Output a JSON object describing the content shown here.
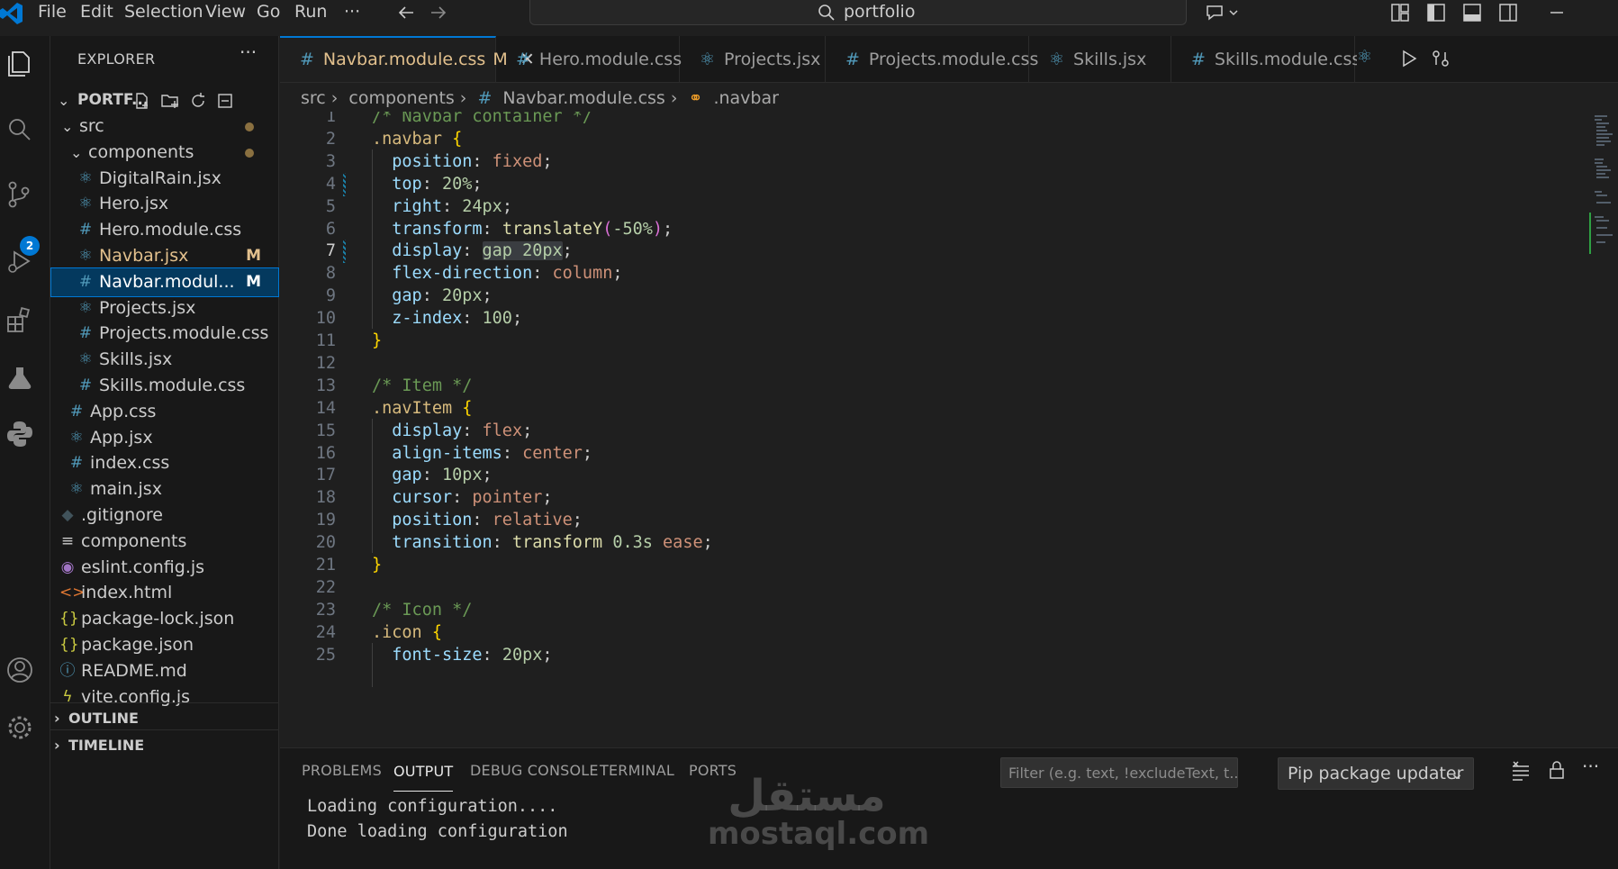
{
  "menu": [
    "File",
    "Edit",
    "Selection",
    "View",
    "Go",
    "Run",
    "···"
  ],
  "search": {
    "value": "portfolio"
  },
  "explorer": {
    "title": "EXPLORER",
    "more": "···",
    "root": "PORTF...",
    "rows": [
      {
        "label": "src",
        "kind": "folder",
        "indent": 1,
        "dot": true
      },
      {
        "label": "components",
        "kind": "folder",
        "indent": 2,
        "dot": true
      },
      {
        "label": "DigitalRain.jsx",
        "kind": "jsx",
        "indent": 3
      },
      {
        "label": "Hero.jsx",
        "kind": "jsx",
        "indent": 3
      },
      {
        "label": "Hero.module.css",
        "kind": "css",
        "indent": 3
      },
      {
        "label": "Navbar.jsx",
        "kind": "jsx",
        "indent": 3,
        "badge": "M"
      },
      {
        "label": "Navbar.modul...",
        "kind": "css",
        "indent": 3,
        "badge": "M",
        "selected": true
      },
      {
        "label": "Projects.jsx",
        "kind": "jsx",
        "indent": 3
      },
      {
        "label": "Projects.module.css",
        "kind": "css",
        "indent": 3
      },
      {
        "label": "Skills.jsx",
        "kind": "jsx",
        "indent": 3
      },
      {
        "label": "Skills.module.css",
        "kind": "css",
        "indent": 3
      },
      {
        "label": "App.css",
        "kind": "css",
        "indent": 2
      },
      {
        "label": "App.jsx",
        "kind": "jsx",
        "indent": 2
      },
      {
        "label": "index.css",
        "kind": "css",
        "indent": 2
      },
      {
        "label": "main.jsx",
        "kind": "jsx",
        "indent": 2
      },
      {
        "label": ".gitignore",
        "kind": "git",
        "indent": 1
      },
      {
        "label": "components",
        "kind": "txt",
        "indent": 1
      },
      {
        "label": "eslint.config.js",
        "kind": "eslint",
        "indent": 1
      },
      {
        "label": "index.html",
        "kind": "html",
        "indent": 1
      },
      {
        "label": "package-lock.json",
        "kind": "json",
        "indent": 1
      },
      {
        "label": "package.json",
        "kind": "json",
        "indent": 1
      },
      {
        "label": "README.md",
        "kind": "info",
        "indent": 1
      },
      {
        "label": "vite.config.js",
        "kind": "vite",
        "indent": 1
      }
    ],
    "outline": "OUTLINE",
    "timeline": "TIMELINE"
  },
  "tabs": [
    {
      "label": "Navbar.module.css",
      "badge": "M",
      "active": true,
      "kind": "css"
    },
    {
      "label": "Hero.module.css",
      "kind": "css"
    },
    {
      "label": "Projects.jsx",
      "kind": "jsx"
    },
    {
      "label": "Projects.module.css",
      "kind": "css"
    },
    {
      "label": "Skills.jsx",
      "kind": "jsx"
    },
    {
      "label": "Skills.module.css",
      "kind": "css"
    }
  ],
  "breadcrumb": {
    "src": "src",
    "components": "components",
    "file": "Navbar.module.css",
    "symbol": ".navbar"
  },
  "active_line": 7,
  "code": [
    {
      "n": "1",
      "tokens": [
        [
          "c",
          "/* Navbar container */"
        ]
      ]
    },
    {
      "n": "2",
      "tokens": [
        [
          "s",
          ".navbar"
        ],
        [
          "p",
          " "
        ],
        [
          "b",
          "{"
        ]
      ]
    },
    {
      "n": "3",
      "tokens": [
        [
          "p",
          "  "
        ],
        [
          "k",
          "position"
        ],
        [
          "p",
          ": "
        ],
        [
          "v",
          "fixed"
        ],
        [
          "p",
          ";"
        ]
      ]
    },
    {
      "n": "4",
      "tokens": [
        [
          "p",
          "  "
        ],
        [
          "k",
          "top"
        ],
        [
          "p",
          ": "
        ],
        [
          "num",
          "20%"
        ],
        [
          "p",
          ";"
        ]
      ]
    },
    {
      "n": "5",
      "tokens": [
        [
          "p",
          "  "
        ],
        [
          "k",
          "right"
        ],
        [
          "p",
          ": "
        ],
        [
          "num",
          "24px"
        ],
        [
          "p",
          ";"
        ]
      ]
    },
    {
      "n": "6",
      "tokens": [
        [
          "p",
          "  "
        ],
        [
          "k",
          "transform"
        ],
        [
          "p",
          ": "
        ],
        [
          "f",
          "translateY"
        ],
        [
          "r",
          "("
        ],
        [
          "num",
          "-50%"
        ],
        [
          "r",
          ")"
        ],
        [
          "p",
          ";"
        ]
      ]
    },
    {
      "n": "7",
      "tokens": [
        [
          "p",
          "  "
        ],
        [
          "k",
          "display"
        ],
        [
          "p",
          ": "
        ],
        [
          "hl",
          "gap 20px"
        ],
        [
          "p",
          ";"
        ]
      ]
    },
    {
      "n": "8",
      "tokens": [
        [
          "p",
          "  "
        ],
        [
          "k",
          "flex-direction"
        ],
        [
          "p",
          ": "
        ],
        [
          "v",
          "column"
        ],
        [
          "p",
          ";"
        ]
      ]
    },
    {
      "n": "9",
      "tokens": [
        [
          "p",
          "  "
        ],
        [
          "k",
          "gap"
        ],
        [
          "p",
          ": "
        ],
        [
          "num",
          "20px"
        ],
        [
          "p",
          ";"
        ]
      ]
    },
    {
      "n": "10",
      "tokens": [
        [
          "p",
          "  "
        ],
        [
          "k",
          "z-index"
        ],
        [
          "p",
          ": "
        ],
        [
          "num",
          "100"
        ],
        [
          "p",
          ";"
        ]
      ]
    },
    {
      "n": "11",
      "tokens": [
        [
          "b",
          "}"
        ]
      ]
    },
    {
      "n": "12",
      "tokens": []
    },
    {
      "n": "13",
      "tokens": [
        [
          "c",
          "/* Item */"
        ]
      ]
    },
    {
      "n": "14",
      "tokens": [
        [
          "s",
          ".navItem"
        ],
        [
          "p",
          " "
        ],
        [
          "b",
          "{"
        ]
      ]
    },
    {
      "n": "15",
      "tokens": [
        [
          "p",
          "  "
        ],
        [
          "k",
          "display"
        ],
        [
          "p",
          ": "
        ],
        [
          "v",
          "flex"
        ],
        [
          "p",
          ";"
        ]
      ]
    },
    {
      "n": "16",
      "tokens": [
        [
          "p",
          "  "
        ],
        [
          "k",
          "align-items"
        ],
        [
          "p",
          ": "
        ],
        [
          "v",
          "center"
        ],
        [
          "p",
          ";"
        ]
      ]
    },
    {
      "n": "17",
      "tokens": [
        [
          "p",
          "  "
        ],
        [
          "k",
          "gap"
        ],
        [
          "p",
          ": "
        ],
        [
          "num",
          "10px"
        ],
        [
          "p",
          ";"
        ]
      ]
    },
    {
      "n": "18",
      "tokens": [
        [
          "p",
          "  "
        ],
        [
          "k",
          "cursor"
        ],
        [
          "p",
          ": "
        ],
        [
          "v",
          "pointer"
        ],
        [
          "p",
          ";"
        ]
      ]
    },
    {
      "n": "19",
      "tokens": [
        [
          "p",
          "  "
        ],
        [
          "k",
          "position"
        ],
        [
          "p",
          ": "
        ],
        [
          "v",
          "relative"
        ],
        [
          "p",
          ";"
        ]
      ]
    },
    {
      "n": "20",
      "tokens": [
        [
          "p",
          "  "
        ],
        [
          "k",
          "transition"
        ],
        [
          "p",
          ": "
        ],
        [
          "t",
          "transform "
        ],
        [
          "num",
          "0.3s"
        ],
        [
          "p",
          " "
        ],
        [
          "v",
          "ease"
        ],
        [
          "p",
          ";"
        ]
      ]
    },
    {
      "n": "21",
      "tokens": [
        [
          "b",
          "}"
        ]
      ]
    },
    {
      "n": "22",
      "tokens": []
    },
    {
      "n": "23",
      "tokens": [
        [
          "c",
          "/* Icon */"
        ]
      ]
    },
    {
      "n": "24",
      "tokens": [
        [
          "s",
          ".icon"
        ],
        [
          "p",
          " "
        ],
        [
          "b",
          "{"
        ]
      ]
    },
    {
      "n": "25",
      "tokens": [
        [
          "p",
          "  "
        ],
        [
          "k",
          "font-size"
        ],
        [
          "p",
          ": "
        ],
        [
          "num",
          "20px"
        ],
        [
          "p",
          ";"
        ]
      ]
    }
  ],
  "panel": {
    "tabs": [
      "PROBLEMS",
      "OUTPUT",
      "DEBUG CONSOLE",
      "TERMINAL",
      "PORTS"
    ],
    "active_tab": "OUTPUT",
    "filter_placeholder": "Filter (e.g. text, !excludeText, t...",
    "channel": "Pip package updater",
    "output": [
      "Loading configuration....",
      "Done loading configuration"
    ]
  },
  "watermark": {
    "arabic": "مستقل",
    "latin": "mostaql.com"
  },
  "colors": {
    "accent": "#0078d4",
    "modified": "#e2c08d",
    "selection": "#04395e"
  }
}
